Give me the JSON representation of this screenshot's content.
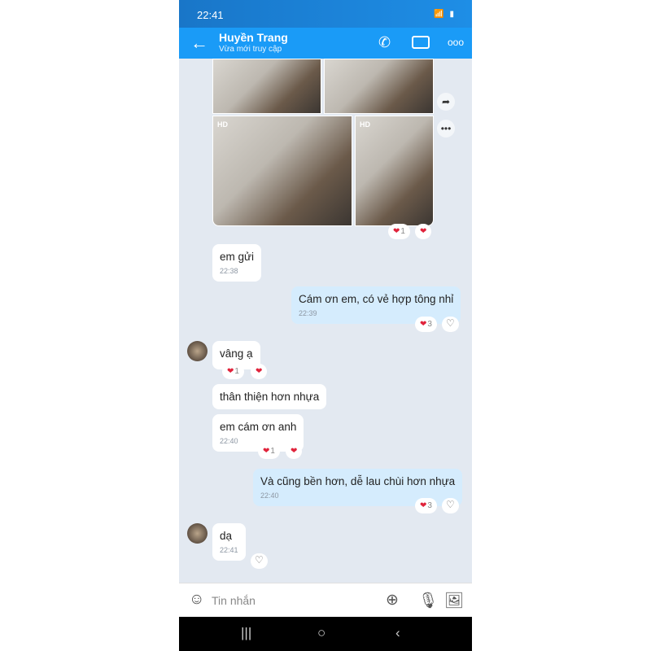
{
  "status": {
    "time": "22:41",
    "icons": "wifi-icon volte-icon signal-icon signal-icon battery-icon"
  },
  "header": {
    "title": "Huyền Trang",
    "subtitle": "Vừa mới truy cập"
  },
  "photos": {
    "hd_label": "HD"
  },
  "messages": [
    {
      "text": "em gửi",
      "time": "22:38",
      "from": "them"
    },
    {
      "text": "Cám ơn em, có vẻ hợp tông nhỉ",
      "time": "22:39",
      "from": "me",
      "reaction_count": "3"
    },
    {
      "text": "vâng ạ",
      "from": "them",
      "reaction_count": "1"
    },
    {
      "text": "thân thiện hơn nhựa",
      "from": "them"
    },
    {
      "text": "em cám ơn anh",
      "time": "22:40",
      "from": "them",
      "reaction_count": "1"
    },
    {
      "text": "Và cũng bền hơn, dễ lau chùi hơn nhựa",
      "time": "22:40",
      "from": "me",
      "reaction_count": "3"
    },
    {
      "text": "dạ",
      "time": "22:41",
      "from": "them"
    }
  ],
  "photo_reaction_count": "1",
  "input": {
    "placeholder": "Tin nhắn"
  },
  "colors": {
    "header": "#1a9bf7",
    "chat_bg": "#e3e9f1",
    "my_bubble": "#d5ecfd",
    "heart": "#e0233b"
  }
}
